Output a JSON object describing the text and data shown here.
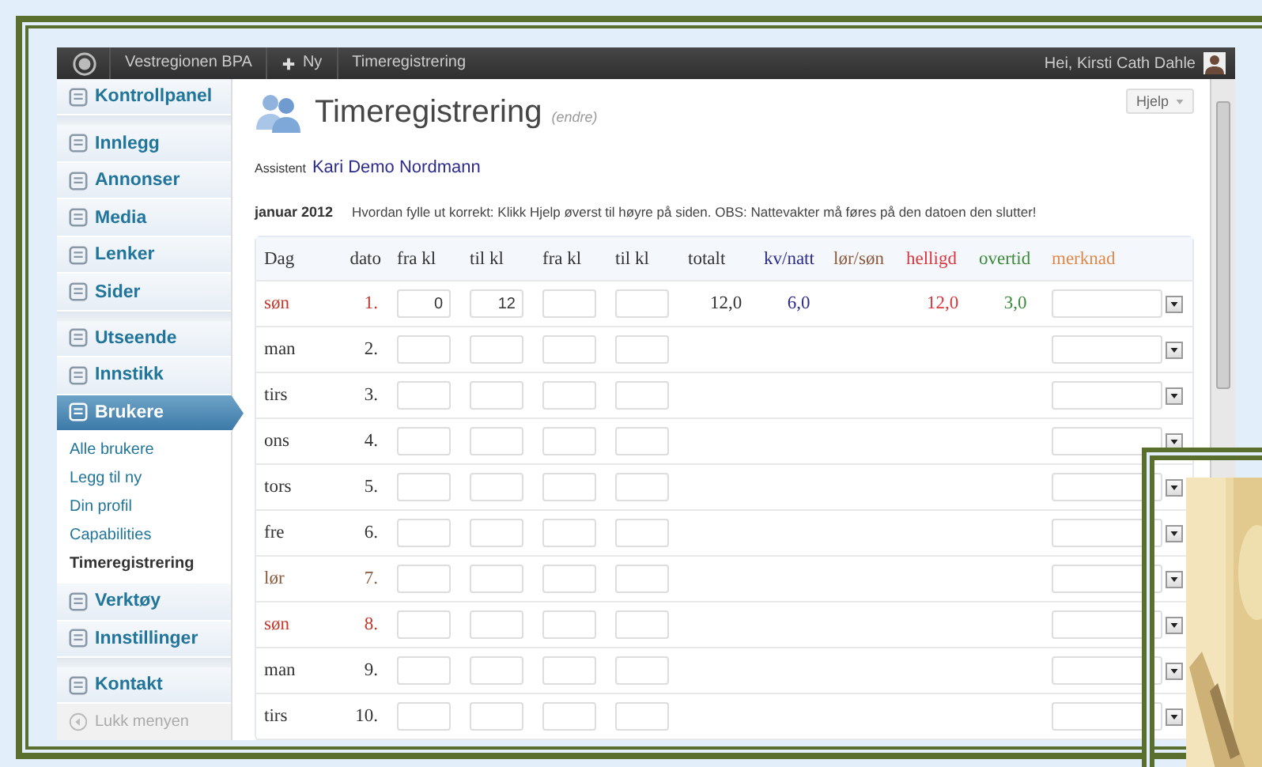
{
  "admin_bar": {
    "site": "Vestregionen BPA",
    "new_label": "Ny",
    "page": "Timeregistrering",
    "greeting": "Hei, Kirsti Cath Dahle"
  },
  "sidebar": {
    "groups": [
      [
        {
          "label": "Kontrollpanel",
          "selected": false
        }
      ],
      [
        {
          "label": "Innlegg",
          "selected": false
        },
        {
          "label": "Annonser",
          "selected": false
        },
        {
          "label": "Media",
          "selected": false
        },
        {
          "label": "Lenker",
          "selected": false
        },
        {
          "label": "Sider",
          "selected": false
        }
      ],
      [
        {
          "label": "Utseende",
          "selected": false
        },
        {
          "label": "Innstikk",
          "selected": false
        },
        {
          "label": "Brukere",
          "selected": true,
          "children": [
            {
              "label": "Alle brukere",
              "selected": false
            },
            {
              "label": "Legg til ny",
              "selected": false
            },
            {
              "label": "Din profil",
              "selected": false
            },
            {
              "label": "Capabilities",
              "selected": false
            },
            {
              "label": "Timeregistrering",
              "selected": true
            }
          ]
        },
        {
          "label": "Verktøy",
          "selected": false
        },
        {
          "label": "Innstillinger",
          "selected": false
        }
      ],
      [
        {
          "label": "Kontakt",
          "selected": false
        }
      ]
    ],
    "collapse_label": "Lukk menyen"
  },
  "page": {
    "title": "Timeregistrering",
    "edit_link": "(endre)",
    "help_button": "Hjelp",
    "assistant_label": "Assistent",
    "assistant_name": "Kari Demo Nordmann",
    "month": "januar 2012",
    "instructions": "Hvordan fylle ut korrekt: Klikk Hjelp øverst til høyre på siden. OBS: Nattevakter må føres på den datoen den slutter!"
  },
  "table": {
    "columns": [
      {
        "label": "Dag",
        "color": "#333333"
      },
      {
        "label": "dato",
        "color": "#333333"
      },
      {
        "label": "fra kl",
        "color": "#333333"
      },
      {
        "label": "til kl",
        "color": "#333333"
      },
      {
        "label": "fra kl",
        "color": "#333333"
      },
      {
        "label": "til kl",
        "color": "#333333"
      },
      {
        "label": "totalt",
        "color": "#333333"
      },
      {
        "label": "kv/natt",
        "color": "#2c2a8a"
      },
      {
        "label": "lør/søn",
        "color": "#8b5a3c"
      },
      {
        "label": "helligd",
        "color": "#d9363e"
      },
      {
        "label": "overtid",
        "color": "#3a8a3a"
      },
      {
        "label": "merknad",
        "color": "#e0884a"
      }
    ],
    "rows": [
      {
        "day": "søn",
        "kind": "sunday",
        "date": "1.",
        "from_1": "0",
        "to_1": "12",
        "total": "12,0",
        "kv_natt": "6,0",
        "helligd": "12,0",
        "overtid": "3,0"
      },
      {
        "day": "man",
        "kind": "weekday",
        "date": "2."
      },
      {
        "day": "tirs",
        "kind": "weekday",
        "date": "3."
      },
      {
        "day": "ons",
        "kind": "weekday",
        "date": "4."
      },
      {
        "day": "tors",
        "kind": "weekday",
        "date": "5."
      },
      {
        "day": "fre",
        "kind": "weekday",
        "date": "6."
      },
      {
        "day": "lør",
        "kind": "saturday",
        "date": "7."
      },
      {
        "day": "søn",
        "kind": "sunday",
        "date": "8."
      },
      {
        "day": "man",
        "kind": "weekday",
        "date": "9."
      },
      {
        "day": "tirs",
        "kind": "weekday",
        "date": "10."
      }
    ]
  }
}
